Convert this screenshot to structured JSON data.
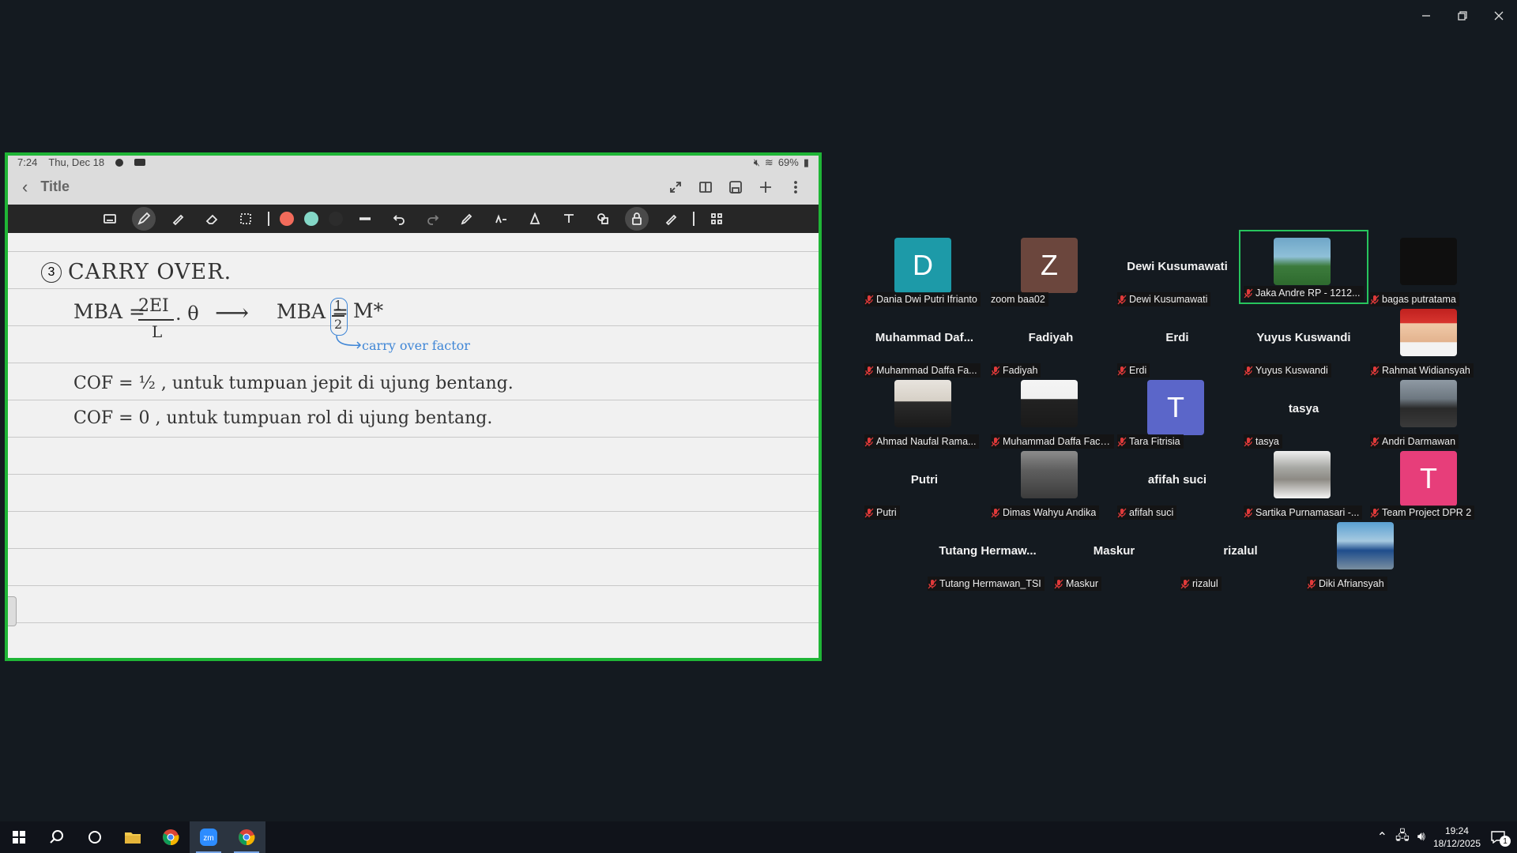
{
  "window_controls": {
    "minimize": "minimize-icon",
    "restore": "restore-icon",
    "close": "close-icon"
  },
  "shared_screen": {
    "status_bar": {
      "time": "7:24",
      "date": "Thu, Dec 18",
      "battery": "69%"
    },
    "title_bar": {
      "title": "Title"
    },
    "toolbar": {
      "colors": [
        "#f26b5b",
        "#84d7c7",
        "#2c2c2c"
      ]
    },
    "note": {
      "heading_number": "3",
      "heading": "CARRY OVER.",
      "eq1_lhs": "MBA =",
      "eq1_num": "2EI",
      "eq1_den": "L",
      "eq1_theta": ". θ",
      "arrow": "⟶",
      "eq2_lhs": "MBA =",
      "eq2_num": "1",
      "eq2_den": "2",
      "eq2_rhs": "M*",
      "cof_note": "carry over factor",
      "line1": "COF = ½ , untuk tumpuan jepit di ujung bentang.",
      "line2": "COF = 0 , untuk tumpuan rol di ujung bentang."
    }
  },
  "participants": [
    {
      "name": "Dania Dwi Putri Ifrianto",
      "initial": "D",
      "color": "#1d9aa8"
    },
    {
      "name": "zoom baa02",
      "initial": "Z",
      "color": "#6b463d"
    },
    {
      "name": "Dewi Kusumawati",
      "display": "Dewi Kusumawati"
    },
    {
      "name": "Jaka Andre RP - 1212...",
      "active": true
    },
    {
      "name": "bagas putratama"
    },
    {
      "name": "Muhammad Daffa Fa...",
      "display": "Muhammad  Daf..."
    },
    {
      "name": "Fadiyah",
      "display": "Fadiyah"
    },
    {
      "name": "Erdi",
      "display": "Erdi"
    },
    {
      "name": "Yuyus Kuswandi",
      "display": "Yuyus Kuswandi"
    },
    {
      "name": "Rahmat Widiansyah"
    },
    {
      "name": "Ahmad Naufal Rama..."
    },
    {
      "name": "Muhammad Daffa Fachr..."
    },
    {
      "name": "Tara Fitrisia",
      "initial": "T",
      "color": "#5b66c9"
    },
    {
      "name": "tasya",
      "display": "tasya"
    },
    {
      "name": "Andri Darmawan"
    },
    {
      "name": "Putri",
      "display": "Putri"
    },
    {
      "name": "Dimas Wahyu Andika"
    },
    {
      "name": "afifah suci",
      "display": "afifah suci"
    },
    {
      "name": "Sartika Purnamasari -...",
      "display": ""
    },
    {
      "name": "Team Project DPR 2",
      "initial": "T",
      "color": "#e73e7a"
    },
    {
      "name": "Tutang Hermawan_TSI",
      "display": "Tutang  Hermaw..."
    },
    {
      "name": "Maskur",
      "display": "Maskur"
    },
    {
      "name": "rizalul",
      "display": "rizalul"
    },
    {
      "name": "Diki Afriansyah"
    }
  ],
  "taskbar": {
    "time": "19:24",
    "date": "18/12/2025",
    "notifications": "1"
  }
}
